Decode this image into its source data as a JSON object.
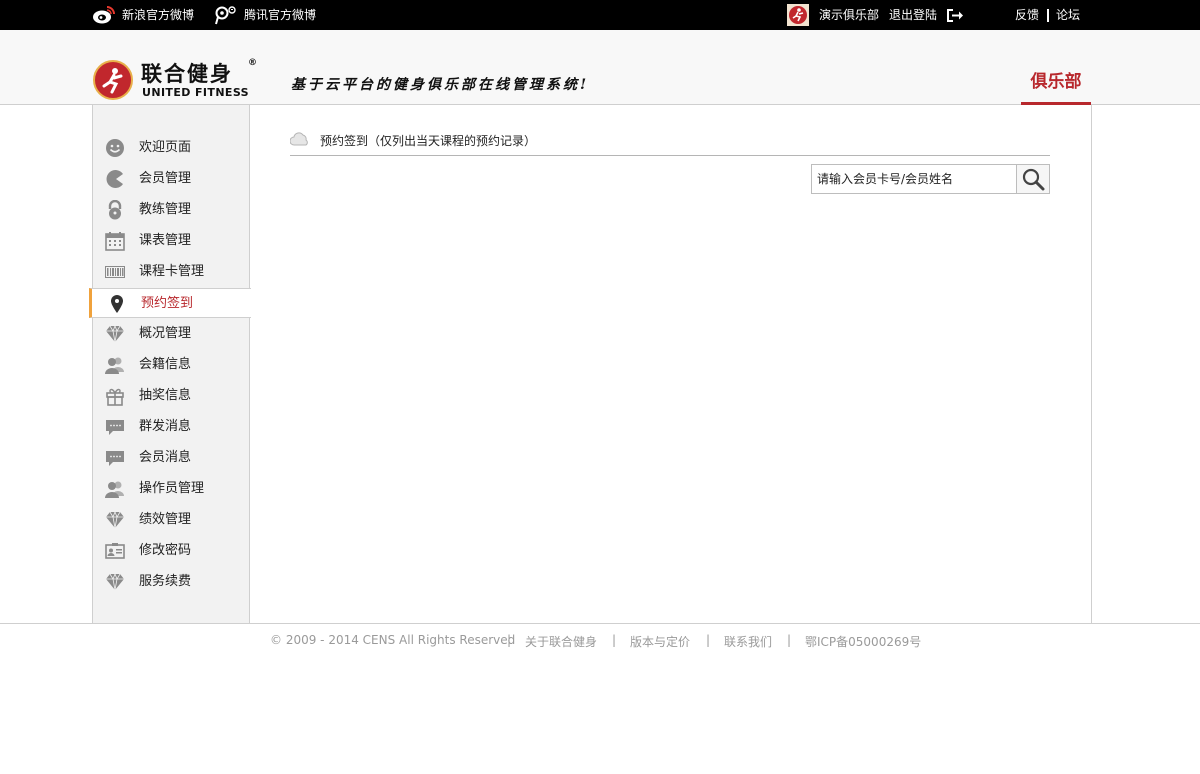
{
  "topbar": {
    "sina_weibo": "新浪官方微博",
    "tencent_weibo": "腾讯官方微博",
    "club_name": "演示俱乐部",
    "logout": "退出登陆",
    "feedback": "反馈",
    "forum": "论坛"
  },
  "header": {
    "brand_cn": "联合健身",
    "brand_reg": "®",
    "brand_en": "UNITED FITNESS",
    "slogan": "基于云平台的健身俱乐部在线管理系统!",
    "club_tab": "俱乐部"
  },
  "sidebar": {
    "items": [
      {
        "label": "欢迎页面",
        "icon": "smiley-icon"
      },
      {
        "label": "会员管理",
        "icon": "pacman-icon"
      },
      {
        "label": "教练管理",
        "icon": "lock-icon"
      },
      {
        "label": "课表管理",
        "icon": "calendar-icon"
      },
      {
        "label": "课程卡管理",
        "icon": "barcode-icon"
      },
      {
        "label": "预约签到",
        "icon": "map-pin-icon"
      },
      {
        "label": "概况管理",
        "icon": "diamond-icon"
      },
      {
        "label": "会籍信息",
        "icon": "users-icon"
      },
      {
        "label": "抽奖信息",
        "icon": "gift-icon"
      },
      {
        "label": "群发消息",
        "icon": "chat-bubble-icon"
      },
      {
        "label": "会员消息",
        "icon": "chat-bubble-icon"
      },
      {
        "label": "操作员管理",
        "icon": "users-icon"
      },
      {
        "label": "绩效管理",
        "icon": "diamond-icon"
      },
      {
        "label": "修改密码",
        "icon": "id-card-icon"
      },
      {
        "label": "服务续费",
        "icon": "diamond-icon"
      }
    ],
    "active_index": 5
  },
  "main": {
    "section_title": "预约签到（仅列出当天课程的预约记录）",
    "search_placeholder": "请输入会员卡号/会员姓名"
  },
  "footer": {
    "copyright": "© 2009 - 2014 CENS All Rights Reserved",
    "sep": "|",
    "about": "关于联合健身",
    "pricing": "版本与定价",
    "contact": "联系我们",
    "icp": "鄂ICP备05000269号"
  },
  "colors": {
    "accent": "#b8282d",
    "active_marker": "#f0a23c"
  }
}
